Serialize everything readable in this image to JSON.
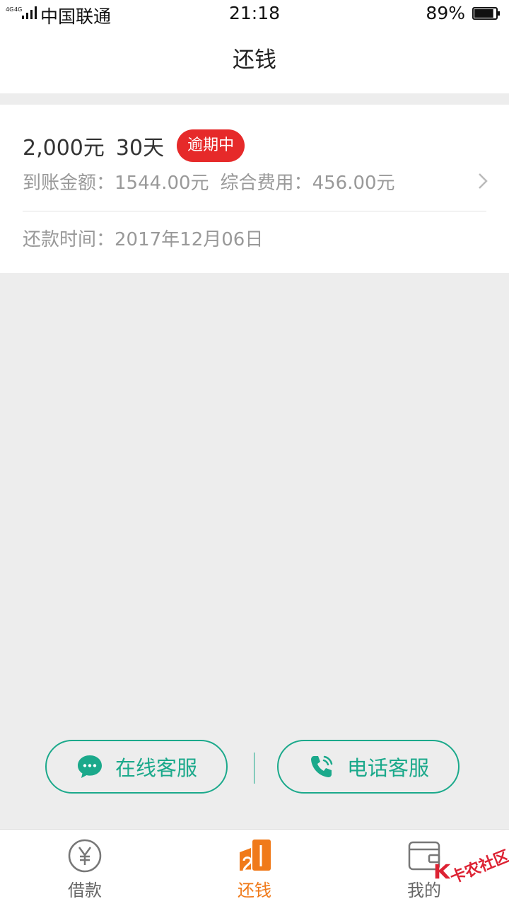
{
  "status_bar": {
    "network": "4G 4G",
    "carrier": "中国联通",
    "time": "21:18",
    "battery_percent": "89%",
    "battery_level": 0.89
  },
  "header": {
    "title": "还钱"
  },
  "loan": {
    "amount": "2,000元",
    "term": "30天",
    "status_badge": "逾期中",
    "received_label": "到账金额：",
    "received_value": "1544.00元",
    "fee_label": "综合费用：",
    "fee_value": "456.00元",
    "repay_time_label": "还款时间：",
    "repay_time_value": "2017年12月06日"
  },
  "service": {
    "online_label": "在线客服",
    "phone_label": "电话客服"
  },
  "tabs": [
    {
      "label": "借款",
      "icon": "yen-circle-icon",
      "active": false
    },
    {
      "label": "还钱",
      "icon": "repay-icon",
      "active": true
    },
    {
      "label": "我的",
      "icon": "wallet-icon",
      "active": false
    }
  ],
  "watermark": {
    "text": "卡农社区"
  },
  "colors": {
    "accent_green": "#1ba98b",
    "active_tab_orange": "#f07a1a",
    "overdue_red": "#e62a2a",
    "background": "#ededed"
  }
}
